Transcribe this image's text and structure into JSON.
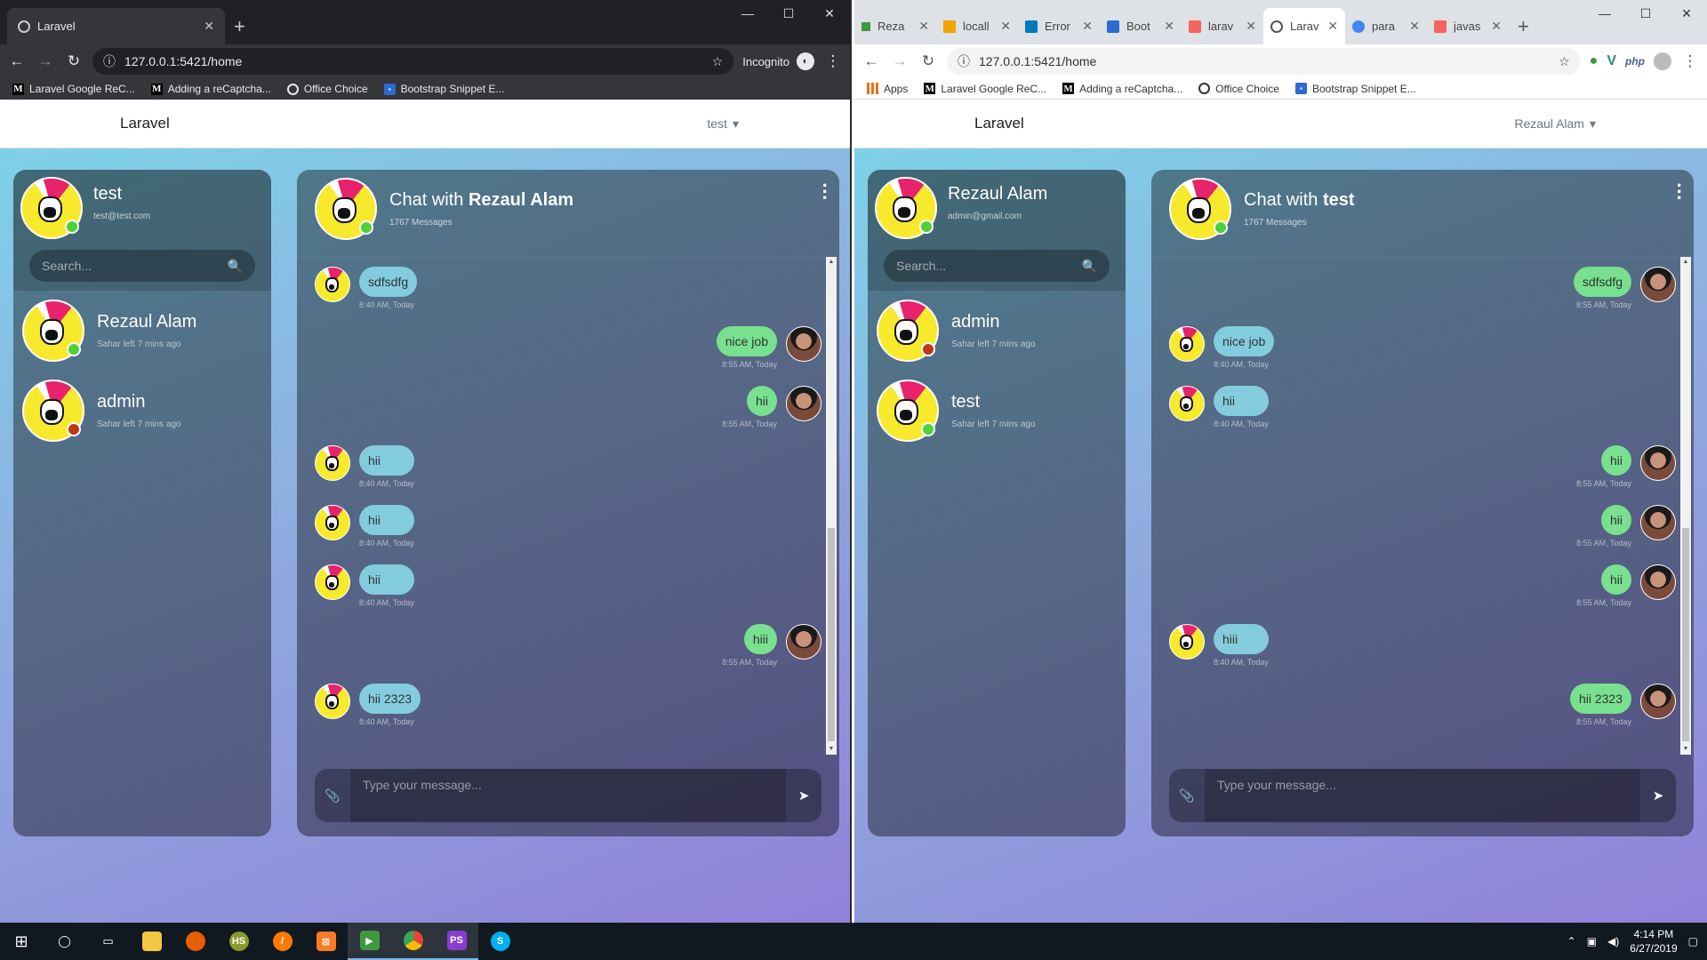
{
  "left_browser": {
    "tab_title": "Laravel",
    "new_tab_symbol": "+",
    "url": "127.0.0.1:5421/home",
    "incognito_label": "Incognito",
    "bookmarks": [
      "Laravel Google ReC...",
      "Adding a reCaptcha...",
      "Office Choice",
      "Bootstrap Snippet E..."
    ]
  },
  "right_browser": {
    "tabs": [
      "Reza",
      "locall",
      "Error",
      "Boot",
      "larav",
      "Larav",
      "para",
      "javas"
    ],
    "url": "127.0.0.1:5421/home",
    "apps_label": "Apps",
    "bookmarks": [
      "Laravel Google ReC...",
      "Adding a reCaptcha...",
      "Office Choice",
      "Bootstrap Snippet E..."
    ],
    "ext_php": "php"
  },
  "left_app": {
    "brand": "Laravel",
    "nav_user": "test",
    "me": {
      "name": "test",
      "email": "test@test.com"
    },
    "search_placeholder": "Search...",
    "contacts": [
      {
        "name": "Rezaul Alam",
        "status_text": "Sahar left 7 mins ago",
        "online": true
      },
      {
        "name": "admin",
        "status_text": "Sahar left 7 mins ago",
        "online": false
      }
    ],
    "chat": {
      "prefix": "Chat with",
      "partner": "Rezaul Alam",
      "count": "1767 Messages",
      "input_placeholder": "Type your message..."
    },
    "messages": [
      {
        "dir": "in",
        "text": "sdfsdfg",
        "time": "8:40 AM, Today"
      },
      {
        "dir": "out",
        "text": "nice job",
        "time": "8:55 AM, Today"
      },
      {
        "dir": "out",
        "text": "hii",
        "time": "8:55 AM, Today"
      },
      {
        "dir": "in",
        "text": "hii",
        "time": "8:40 AM, Today"
      },
      {
        "dir": "in",
        "text": "hii",
        "time": "8:40 AM, Today"
      },
      {
        "dir": "in",
        "text": "hii",
        "time": "8:40 AM, Today"
      },
      {
        "dir": "out",
        "text": "hiii",
        "time": "8:55 AM, Today"
      },
      {
        "dir": "in",
        "text": "hii 2323",
        "time": "8:40 AM, Today"
      }
    ]
  },
  "right_app": {
    "brand": "Laravel",
    "nav_user": "Rezaul Alam",
    "me": {
      "name": "Rezaul Alam",
      "email": "admin@gmail.com"
    },
    "search_placeholder": "Search...",
    "contacts": [
      {
        "name": "admin",
        "status_text": "Sahar left 7 mins ago",
        "online": false
      },
      {
        "name": "test",
        "status_text": "Sahar left 7 mins ago",
        "online": true
      }
    ],
    "chat": {
      "prefix": "Chat with",
      "partner": "test",
      "count": "1767 Messages",
      "input_placeholder": "Type your message..."
    },
    "messages": [
      {
        "dir": "out",
        "text": "sdfsdfg",
        "time": "8:55 AM, Today"
      },
      {
        "dir": "in",
        "text": "nice job",
        "time": "8:40 AM, Today"
      },
      {
        "dir": "in",
        "text": "hii",
        "time": "8:40 AM, Today"
      },
      {
        "dir": "out",
        "text": "hii",
        "time": "8:55 AM, Today"
      },
      {
        "dir": "out",
        "text": "hii",
        "time": "8:55 AM, Today"
      },
      {
        "dir": "out",
        "text": "hii",
        "time": "8:55 AM, Today"
      },
      {
        "dir": "in",
        "text": "hiii",
        "time": "8:40 AM, Today"
      },
      {
        "dir": "out",
        "text": "hii 2323",
        "time": "8:55 AM, Today"
      }
    ]
  },
  "taskbar": {
    "time": "4:14 PM",
    "date": "6/27/2019"
  },
  "colors": {
    "incoming_bubble": "#82ccdd",
    "outgoing_bubble": "#78e08f",
    "online": "#4cd137",
    "offline": "#c23616"
  }
}
